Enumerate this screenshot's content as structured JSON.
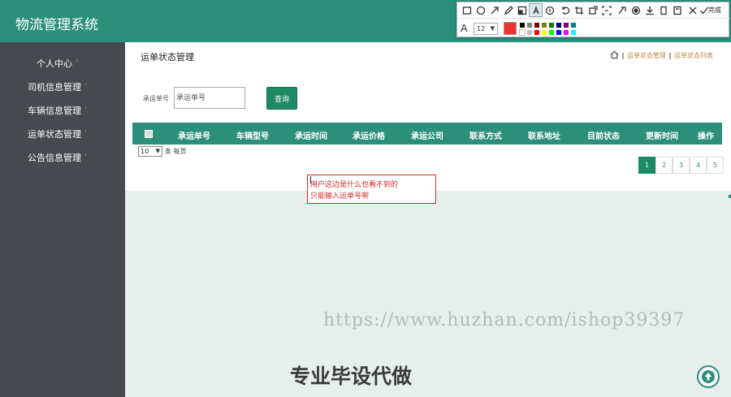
{
  "header": {
    "title": "物流管理系统"
  },
  "sidebar": {
    "items": [
      {
        "label": "个人中心"
      },
      {
        "label": "司机信息管理"
      },
      {
        "label": "车辆信息管理"
      },
      {
        "label": "运单状态管理"
      },
      {
        "label": "公告信息管理"
      }
    ]
  },
  "page": {
    "title": "运单状态管理",
    "breadcrumb": [
      "运单状态管理",
      "运单状态列表"
    ]
  },
  "search": {
    "label": "承运单号",
    "placeholder": "承运单号",
    "button": "查询"
  },
  "table": {
    "columns": [
      "承运单号",
      "车辆型号",
      "承运时间",
      "承运价格",
      "承运公司",
      "联系方式",
      "联系地址",
      "目前状态",
      "更新时间",
      "操作"
    ]
  },
  "pagination": {
    "page_size": "10",
    "page_size_suffix": "条 每页",
    "pages": [
      "1",
      "2",
      "3",
      "4",
      "5"
    ],
    "current": "1"
  },
  "annotation": {
    "lines": [
      "用户这边是什么也看不到的",
      "只能输入运单号啊"
    ]
  },
  "annotation_toolbar": {
    "done_label": "完成",
    "font_size": "12",
    "current_color": "#ee3333",
    "tools": [
      "rectangle-icon",
      "ellipse-icon",
      "arrow-icon",
      "pencil-icon",
      "mosaic-icon",
      "text-icon",
      "number-icon",
      "undo-icon",
      "crop-icon",
      "pin-icon",
      "ocr-icon",
      "eraser-icon",
      "record-icon",
      "download-icon",
      "copy-icon",
      "save-icon",
      "close-icon",
      "check-icon"
    ],
    "palette": [
      "#000000",
      "#808080",
      "#800000",
      "#808000",
      "#008000",
      "#000080",
      "#800080",
      "#008080",
      "#ffffff",
      "#c0c0c0",
      "#ff0000",
      "#ffff00",
      "#00ff00",
      "#0000ff",
      "#ff00ff",
      "#00ffff"
    ]
  },
  "watermark": "https://www.huzhan.com/ishop39397",
  "banner": "专业毕设代做",
  "colors": {
    "primary": "#2c8f7c",
    "sidebar": "#464a4f",
    "button": "#1e8a63",
    "annotation": "#d42a2a"
  }
}
